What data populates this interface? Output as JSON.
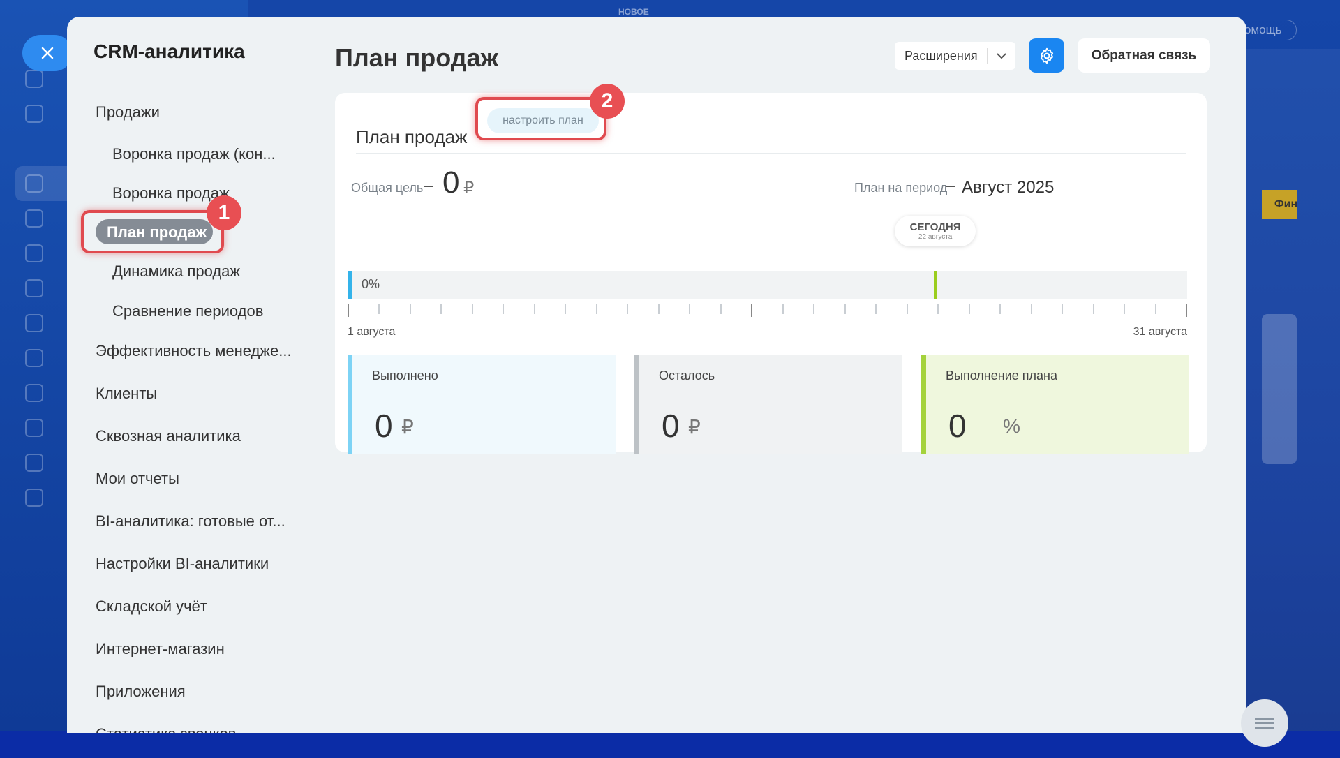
{
  "background": {
    "top_badge": "НОВОЕ",
    "help_label": "омощь",
    "right_card_label": "Фин"
  },
  "panel": {
    "nav_title": "CRM-аналитика",
    "nav_items": [
      {
        "label": "Продажи"
      },
      {
        "label": "Воронка продаж (кон..."
      },
      {
        "label": "Воронка продаж"
      },
      {
        "label": "План продаж",
        "active": true
      },
      {
        "label": "Динамика продаж"
      },
      {
        "label": "Сравнение периодов"
      },
      {
        "label": "Эффективность менедже..."
      },
      {
        "label": "Клиенты"
      },
      {
        "label": "Сквозная аналитика"
      },
      {
        "label": "Мои отчеты"
      },
      {
        "label": "BI-аналитика: готовые от..."
      },
      {
        "label": "Настройки BI-аналитики"
      },
      {
        "label": "Складской учёт"
      },
      {
        "label": "Интернет-магазин"
      },
      {
        "label": "Приложения"
      },
      {
        "label": "Статистика звонков"
      }
    ],
    "page_title": "План продаж",
    "toolbar": {
      "extensions_label": "Расширения",
      "feedback_label": "Обратная связь"
    },
    "plan_card": {
      "title": "План продаж",
      "configure_label": "настроить план",
      "goal_label": "Общая цель",
      "goal_value": "0",
      "goal_currency": "₽",
      "period_label": "План на период",
      "period_value": "Август 2025",
      "today_label": "СЕГОДНЯ",
      "today_date": "22 августа",
      "progress_text": "0%",
      "progress_fraction": 0.0,
      "today_day": 22,
      "days_in_month": 31,
      "start_label": "1 августа",
      "end_label": "31 августа",
      "kpis": [
        {
          "label": "Выполнено",
          "value": "0",
          "unit": "₽"
        },
        {
          "label": "Осталось",
          "value": "0",
          "unit": "₽"
        },
        {
          "label": "Выполнение плана",
          "value": "0",
          "unit": "%"
        }
      ]
    }
  },
  "annotations": {
    "marker_1": "1",
    "marker_2": "2"
  },
  "colors": {
    "accent": "#1a86f1",
    "annotation": "#e04a4f",
    "plan_green": "#a4d23c",
    "done_blue": "#7dd3f5"
  }
}
